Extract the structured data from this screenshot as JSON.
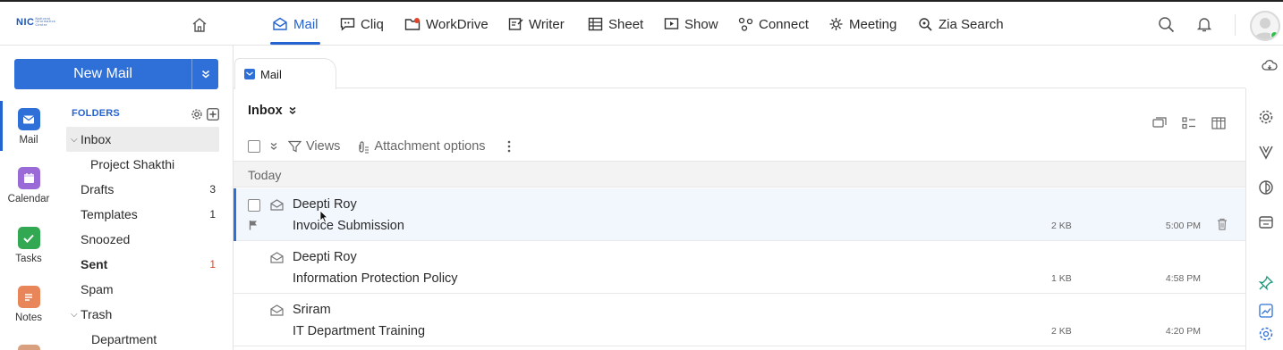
{
  "brand": {
    "logo_text": "NIC",
    "logo_sub": "National Informatics Centre"
  },
  "topnav": {
    "tabs": [
      {
        "label": "Mail",
        "icon": "mail-icon",
        "active": true
      },
      {
        "label": "Cliq",
        "icon": "chat-icon"
      },
      {
        "label": "WorkDrive",
        "icon": "drive-icon"
      },
      {
        "label": "Writer",
        "icon": "writer-icon"
      },
      {
        "label": "Sheet",
        "icon": "sheet-icon"
      },
      {
        "label": "Show",
        "icon": "show-icon"
      },
      {
        "label": "Connect",
        "icon": "connect-icon"
      },
      {
        "label": "Meeting",
        "icon": "meeting-icon"
      },
      {
        "label": "Zia Search",
        "icon": "zia-search-icon"
      }
    ]
  },
  "new_mail": {
    "label": "New Mail"
  },
  "appnav": [
    {
      "label": "Mail",
      "color": "#2e6fd8",
      "active": true
    },
    {
      "label": "Calendar",
      "color": "#9a6ad6"
    },
    {
      "label": "Tasks",
      "color": "#33a852"
    },
    {
      "label": "Notes",
      "color": "#e8865a"
    }
  ],
  "folders": {
    "header": "FOLDERS",
    "items": [
      {
        "name": "Inbox",
        "count": "",
        "selected": true,
        "expanded": true
      },
      {
        "name": "Project Shakthi",
        "count": ""
      },
      {
        "name": "Drafts",
        "count": "3"
      },
      {
        "name": "Templates",
        "count": "1"
      },
      {
        "name": "Snoozed",
        "count": ""
      },
      {
        "name": "Sent",
        "count": "1",
        "bold": true
      },
      {
        "name": "Spam",
        "count": ""
      },
      {
        "name": "Trash",
        "count": "",
        "expanded": true
      },
      {
        "name": "Department",
        "count": ""
      }
    ]
  },
  "tab": {
    "label": "Mail"
  },
  "list": {
    "title": "Inbox",
    "toolbar": {
      "views": "Views",
      "attachment_options": "Attachment options"
    },
    "group_label": "Today",
    "emails": [
      {
        "sender": "Deepti Roy",
        "subject": "Invoice Submission",
        "size": "2 KB",
        "time": "5:00 PM"
      },
      {
        "sender": "Deepti Roy",
        "subject": "Information Protection Policy",
        "size": "1 KB",
        "time": "4:58 PM"
      },
      {
        "sender": "Sriram",
        "subject": "IT Department Training",
        "size": "2 KB",
        "time": "4:20 PM"
      }
    ]
  },
  "colors": {
    "accent": "#2e6fd8",
    "sent_count": "#e0452b"
  }
}
